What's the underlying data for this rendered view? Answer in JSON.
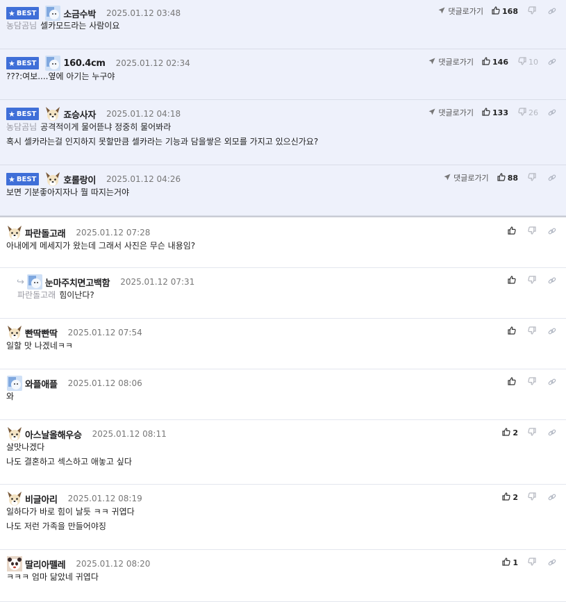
{
  "common": {
    "best_label": "BEST",
    "go_reply_label": "댓글로가기"
  },
  "colors": {
    "best_bg": "#eef1fb",
    "badge": "#3f6fd8",
    "mention": "#9a9aa3"
  },
  "comments": [
    {
      "best": true,
      "avatar": "ice-avatar",
      "nick": "소금수박",
      "date": "2025.01.12 03:48",
      "mention": "농담곰님",
      "lines": [
        "셀카모드라는 사람이요"
      ],
      "up": "168",
      "down": ""
    },
    {
      "best": true,
      "avatar": "ice-avatar",
      "nick": "160.4cm",
      "date": "2025.01.12 02:34",
      "mention": "",
      "lines": [
        "???:여보....옆에 아기는 누구야"
      ],
      "up": "146",
      "down": "10"
    },
    {
      "best": true,
      "avatar": "dog-avatar",
      "nick": "죠승사자",
      "date": "2025.01.12 04:18",
      "mention": "농담곰님",
      "lines": [
        "공격적이게 물어뜯냐 정중히 물어봐라",
        "혹시 셀카라는걸 인지하지 못할만큼 셀카라는 기능과 담을쌓은 외모를 가지고 있으신가요?"
      ],
      "up": "133",
      "down": "26"
    },
    {
      "best": true,
      "avatar": "dog-avatar",
      "nick": "호롤랑이",
      "date": "2025.01.12 04:26",
      "mention": "",
      "lines": [
        "보면 기분좋아지자나 뭘 따지는거야"
      ],
      "up": "88",
      "down": ""
    },
    {
      "best": false,
      "avatar": "dog-avatar",
      "nick": "파란돌고래",
      "date": "2025.01.12 07:28",
      "mention": "",
      "lines": [
        "아내에게 메세지가 왔는데 그래서 사진은 무슨 내용임?"
      ],
      "up": "",
      "down": ""
    },
    {
      "best": false,
      "reply": true,
      "avatar": "ice-avatar",
      "nick": "눈마주치면고백함",
      "date": "2025.01.12 07:31",
      "mention": "파란돌고래",
      "lines": [
        "힘이난다?"
      ],
      "up": "",
      "down": ""
    },
    {
      "best": false,
      "avatar": "dog-avatar",
      "nick": "빤딱빤딱",
      "date": "2025.01.12 07:54",
      "mention": "",
      "lines": [
        "일할 맛 나겠네ㅋㅋ"
      ],
      "up": "",
      "down": ""
    },
    {
      "best": false,
      "avatar": "ice-avatar",
      "nick": "와플애플",
      "date": "2025.01.12 08:06",
      "mention": "",
      "lines": [
        "와"
      ],
      "up": "",
      "down": ""
    },
    {
      "best": false,
      "avatar": "dog-avatar",
      "nick": "아스날올해우승",
      "date": "2025.01.12 08:11",
      "mention": "",
      "lines": [
        "살맛나겠다",
        "나도 결혼하고 섹스하고 애놓고 싶다"
      ],
      "up": "2",
      "down": ""
    },
    {
      "best": false,
      "avatar": "dog-avatar",
      "nick": "비글아리",
      "date": "2025.01.12 08:19",
      "mention": "",
      "lines": [
        "일하다가 바로 힘이 날듯 ㅋㅋ 귀엽다",
        "나도 저런 가족을 만들어야징"
      ],
      "up": "2",
      "down": ""
    },
    {
      "best": false,
      "avatar": "panda-avatar",
      "nick": "딸리아뗄레",
      "date": "2025.01.12 08:20",
      "mention": "",
      "lines": [
        "ㅋㅋㅋ 엄마 닮았네 귀엽다"
      ],
      "up": "1",
      "down": ""
    }
  ]
}
